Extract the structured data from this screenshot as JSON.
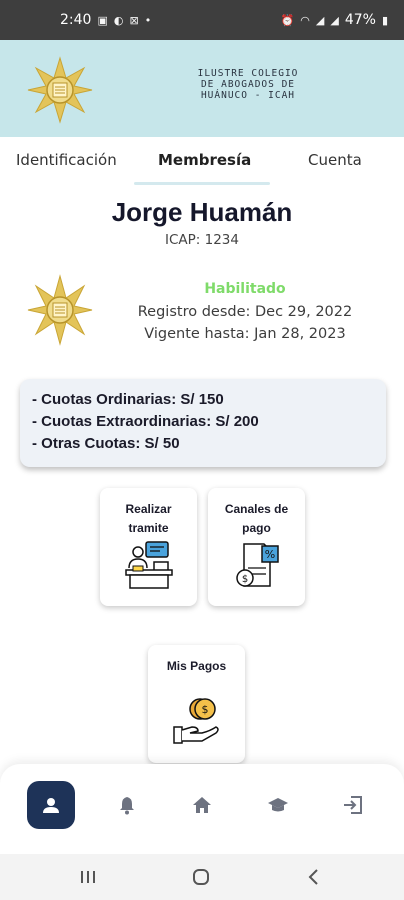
{
  "status_bar": {
    "time": "2:40",
    "battery": "47%",
    "left_icons": [
      "image-icon",
      "d-icon",
      "cast-icon",
      "dot-icon"
    ],
    "right_icons": [
      "alarm-icon",
      "wifi-icon",
      "signal-icon",
      "signal-icon",
      "battery-icon"
    ]
  },
  "header": {
    "org_line_1": "ILUSTRE COLEGIO",
    "org_line_2": "DE ABOGADOS DE",
    "org_line_3": "HUÁNUCO - ICAH"
  },
  "tabs": [
    {
      "label": "Identificación"
    },
    {
      "label": "Membresía"
    },
    {
      "label": "Cuenta"
    }
  ],
  "member": {
    "name": "Jorge Huamán",
    "icap": "ICAP: 1234",
    "status": "Habilitado",
    "registro": "Registro desde: Dec 29, 2022",
    "vigente": "Vigente hasta: Jan 28, 2023"
  },
  "quotas": [
    "- Cuotas Ordinarias: S/ 150",
    "- Cuotas Extraordinarias: S/ 200",
    "- Otras Cuotas: S/ 50"
  ],
  "actions": {
    "tramite": {
      "line1": "Realizar",
      "line2": "tramite"
    },
    "canales": {
      "line1": "Canales de",
      "line2": "pago"
    },
    "pagos": {
      "line1": "Mis Pagos"
    }
  },
  "bottom_nav": [
    "user-icon",
    "bell-icon",
    "home-icon",
    "graduation-cap-icon",
    "logout-icon"
  ],
  "colors": {
    "header_bg": "#c6e6ea",
    "status_green": "#7fdb6a",
    "nav_active": "#1e3358",
    "gold": "#d8b43a"
  }
}
